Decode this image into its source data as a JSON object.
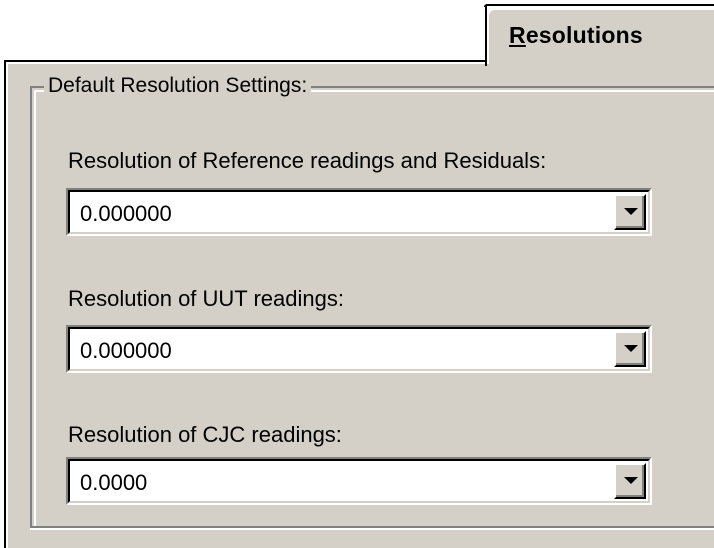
{
  "tab": {
    "accelerator": "R",
    "label_rest": "esolutions"
  },
  "group": {
    "title": "Default Resolution Settings:"
  },
  "fields": [
    {
      "label": "Resolution of Reference readings and Residuals:",
      "value": "0.000000"
    },
    {
      "label": "Resolution of UUT readings:",
      "value": "0.000000"
    },
    {
      "label": "Resolution of CJC readings:",
      "value": "0.0000"
    }
  ],
  "icons": {
    "dropdown": "chevron-down-icon"
  },
  "colors": {
    "face": "#d4d0c8",
    "shadow": "#808080",
    "highlight": "#ffffff"
  }
}
